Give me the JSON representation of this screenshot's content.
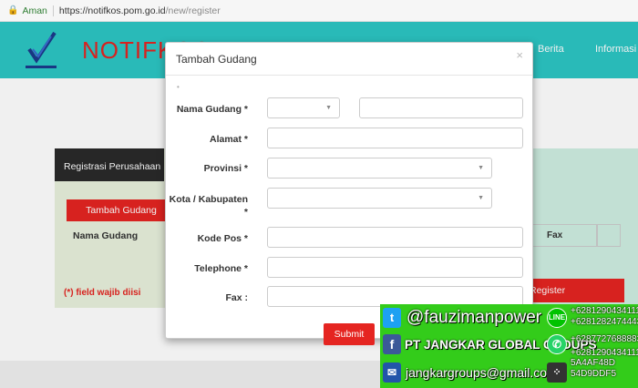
{
  "browser": {
    "secure_label": "Aman",
    "url_host": "https://notifkos.pom.go.id",
    "url_path": "/new/register"
  },
  "header": {
    "brand": "NOTIFKOS",
    "nav": [
      "Berita",
      "Informasi"
    ]
  },
  "background": {
    "tab_label": "Registrasi Perusahaan",
    "add_button": "Tambah Gudang",
    "column_nama": "Nama Gudang",
    "column_fax": "Fax",
    "required_note": "(*) field wajib diisi",
    "register_button": "Register"
  },
  "modal": {
    "title": "Tambah Gudang",
    "close": "×",
    "fields": {
      "nama_gudang": "Nama Gudang *",
      "alamat": "Alamat *",
      "provinsi": "Provinsi *",
      "kota": "Kota / Kabupaten *",
      "kode_pos": "Kode Pos *",
      "telephone": "Telephone *",
      "fax": "Fax :"
    },
    "submit": "Submit"
  },
  "watermark": {
    "twitter": "@fauzimanpower",
    "facebook": "PT JANGKAR GLOBAL GROUPS",
    "email": "jangkargroups@gmail.com",
    "line": "+6281290434111",
    "phone_a": "+6281282474443",
    "whatsapp": "+6287727688883",
    "phone_b": "+6281290434111",
    "bbm_a": "5A4AF48D",
    "bbm_b": "54D9DDF5"
  },
  "colors": {
    "accent": "#2cc6c4",
    "brand_red": "#e52521"
  }
}
